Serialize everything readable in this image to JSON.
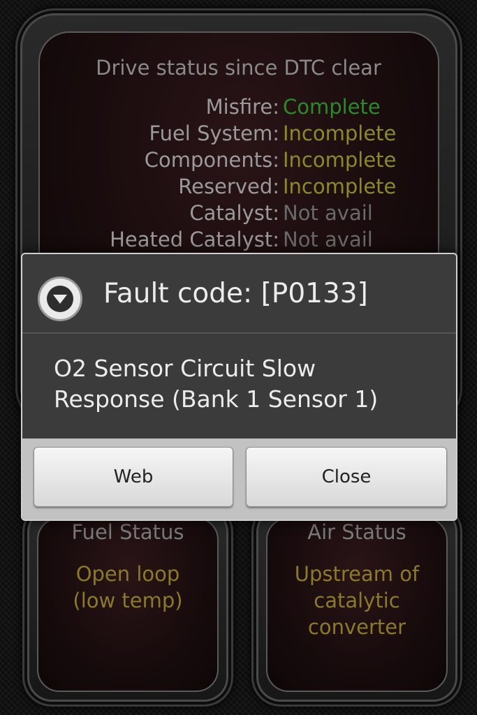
{
  "drive_status": {
    "title": "Drive status since DTC clear",
    "items": [
      {
        "label": "Misfire:",
        "value": "Complete",
        "state": "complete"
      },
      {
        "label": "Fuel System:",
        "value": "Incomplete",
        "state": "incomplete"
      },
      {
        "label": "Components:",
        "value": "Incomplete",
        "state": "incomplete"
      },
      {
        "label": "Reserved:",
        "value": "Incomplete",
        "state": "incomplete"
      },
      {
        "label": "Catalyst:",
        "value": "Not avail",
        "state": "na"
      },
      {
        "label": "Heated Catalyst:",
        "value": "Not avail",
        "state": "na"
      }
    ]
  },
  "fuel_status": {
    "title": "Fuel Status",
    "line1": "Open loop",
    "line2": "(low temp)"
  },
  "air_status": {
    "title": "Air Status",
    "line1": "Upstream of",
    "line2": "catalytic",
    "line3": "converter"
  },
  "dialog": {
    "title": "Fault code: [P0133]",
    "message_line1": "O2 Sensor Circuit Slow",
    "message_line2": "Response (Bank 1 Sensor 1)",
    "web_label": "Web",
    "close_label": "Close"
  },
  "colors": {
    "complete": "#2a8a2a",
    "incomplete": "#8a8a2a",
    "na": "#6a6a6a"
  }
}
